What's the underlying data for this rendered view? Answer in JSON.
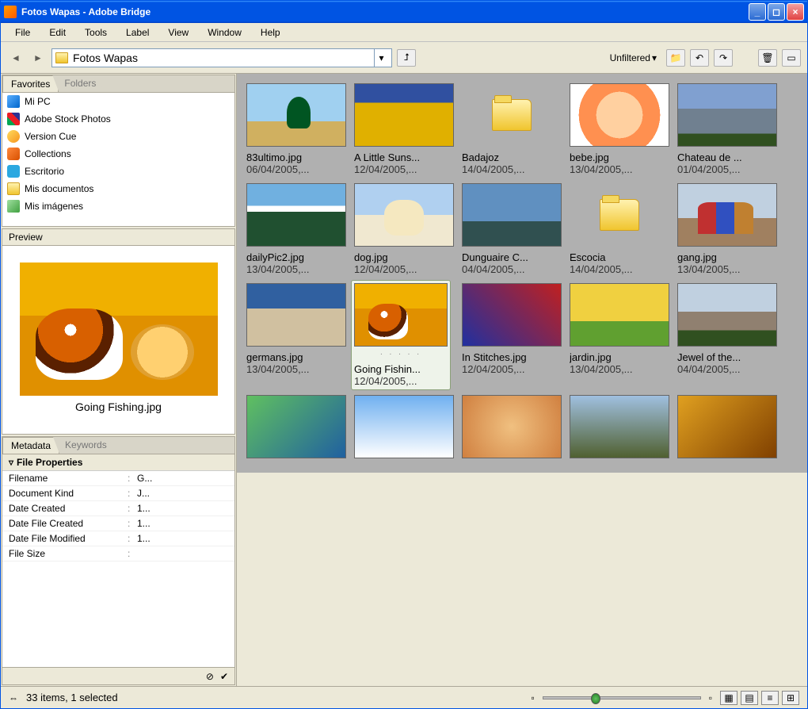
{
  "window": {
    "title": "Fotos Wapas - Adobe Bridge"
  },
  "menu": [
    "File",
    "Edit",
    "Tools",
    "Label",
    "View",
    "Window",
    "Help"
  ],
  "toolbar": {
    "path": "Fotos Wapas",
    "filter_label": "Unfiltered"
  },
  "sidebar": {
    "tabs_fav": {
      "active": "Favorites",
      "inactive": "Folders"
    },
    "fav_items": [
      {
        "label": "Mi PC",
        "icon": "ic-pc"
      },
      {
        "label": "Adobe Stock Photos",
        "icon": "ic-stock"
      },
      {
        "label": "Version Cue",
        "icon": "ic-ver"
      },
      {
        "label": "Collections",
        "icon": "ic-coll"
      },
      {
        "label": "Escritorio",
        "icon": "ic-desk"
      },
      {
        "label": "Mis documentos",
        "icon": "ic-folder"
      },
      {
        "label": "Mis imágenes",
        "icon": "ic-img"
      }
    ],
    "preview": {
      "header": "Preview",
      "caption": "Going Fishing.jpg"
    },
    "meta_tabs": {
      "active": "Metadata",
      "inactive": "Keywords"
    },
    "meta_section": "File Properties",
    "meta_rows": [
      {
        "k": "Filename",
        "v": "G..."
      },
      {
        "k": "Document Kind",
        "v": "J..."
      },
      {
        "k": "Date Created",
        "v": "1..."
      },
      {
        "k": "Date File Created",
        "v": "1..."
      },
      {
        "k": "Date File Modified",
        "v": "1..."
      },
      {
        "k": "File Size",
        "v": ""
      }
    ]
  },
  "grid": [
    {
      "name": "83ultimo.jpg",
      "date": "06/04/2005,...",
      "type": "img",
      "cls": "t-tree"
    },
    {
      "name": "A Little Suns...",
      "date": "12/04/2005,...",
      "type": "img",
      "cls": "t-sunfl"
    },
    {
      "name": "Badajoz",
      "date": "14/04/2005,...",
      "type": "folder",
      "cls": ""
    },
    {
      "name": "bebe.jpg",
      "date": "13/04/2005,...",
      "type": "img",
      "cls": "t-baby"
    },
    {
      "name": "Chateau de ...",
      "date": "01/04/2005,...",
      "type": "img",
      "cls": "t-castle"
    },
    {
      "name": "dailyPic2.jpg",
      "date": "13/04/2005,...",
      "type": "img",
      "cls": "t-mtn"
    },
    {
      "name": "dog.jpg",
      "date": "12/04/2005,...",
      "type": "img",
      "cls": "t-dog"
    },
    {
      "name": "Dunguaire C...",
      "date": "04/04/2005,...",
      "type": "img",
      "cls": "t-dung"
    },
    {
      "name": "Escocia",
      "date": "14/04/2005,...",
      "type": "folder",
      "cls": ""
    },
    {
      "name": "gang.jpg",
      "date": "13/04/2005,...",
      "type": "img",
      "cls": "t-gang"
    },
    {
      "name": "germans.jpg",
      "date": "13/04/2005,...",
      "type": "img",
      "cls": "t-germ"
    },
    {
      "name": "Going Fishin...",
      "date": "12/04/2005,...",
      "type": "img",
      "cls": "t-cat",
      "selected": true,
      "rating": ". . . . ."
    },
    {
      "name": "In Stitches.jpg",
      "date": "12/04/2005,...",
      "type": "img",
      "cls": "t-stitch"
    },
    {
      "name": "jardin.jpg",
      "date": "13/04/2005,...",
      "type": "img",
      "cls": "t-jardin"
    },
    {
      "name": "Jewel of the...",
      "date": "04/04/2005,...",
      "type": "img",
      "cls": "t-jewel"
    },
    {
      "name": "",
      "date": "",
      "type": "img",
      "cls": "t-gen1"
    },
    {
      "name": "",
      "date": "",
      "type": "img",
      "cls": "t-gen2"
    },
    {
      "name": "",
      "date": "",
      "type": "img",
      "cls": "t-gen3"
    },
    {
      "name": "",
      "date": "",
      "type": "img",
      "cls": "t-gen4"
    },
    {
      "name": "",
      "date": "",
      "type": "img",
      "cls": "t-gen5"
    }
  ],
  "status": {
    "text": "33 items, 1 selected"
  }
}
